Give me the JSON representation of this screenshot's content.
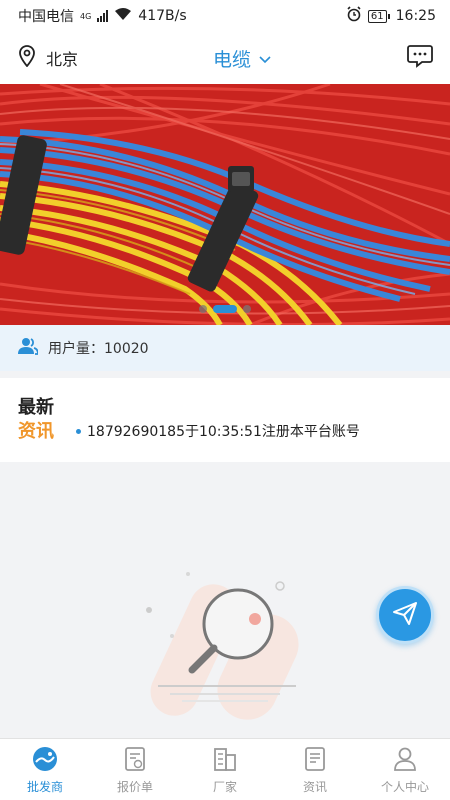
{
  "status_bar": {
    "carrier": "中国电信",
    "network": "4G",
    "speed": "417B/s",
    "battery": "61",
    "time": "16:25"
  },
  "header": {
    "location": "北京",
    "title": "电缆"
  },
  "banner": {
    "slide_count": 3,
    "active_slide": 2
  },
  "stats": {
    "users_label": "用户量：",
    "users_value": "10020"
  },
  "news": {
    "title_line1": "最新",
    "title_line2": "资讯",
    "items": [
      "18792690185于10:35:51注册本平台账号"
    ]
  },
  "tabs": [
    {
      "label": "批发商",
      "active": true,
      "icon": "globe-icon"
    },
    {
      "label": "报价单",
      "active": false,
      "icon": "quote-doc-icon"
    },
    {
      "label": "厂家",
      "active": false,
      "icon": "factory-icon"
    },
    {
      "label": "资讯",
      "active": false,
      "icon": "news-doc-icon"
    },
    {
      "label": "个人中心",
      "active": false,
      "icon": "person-icon"
    }
  ],
  "colors": {
    "accent": "#2a8fd6",
    "news_highlight": "#f0962a",
    "tab_inactive": "#999999"
  }
}
